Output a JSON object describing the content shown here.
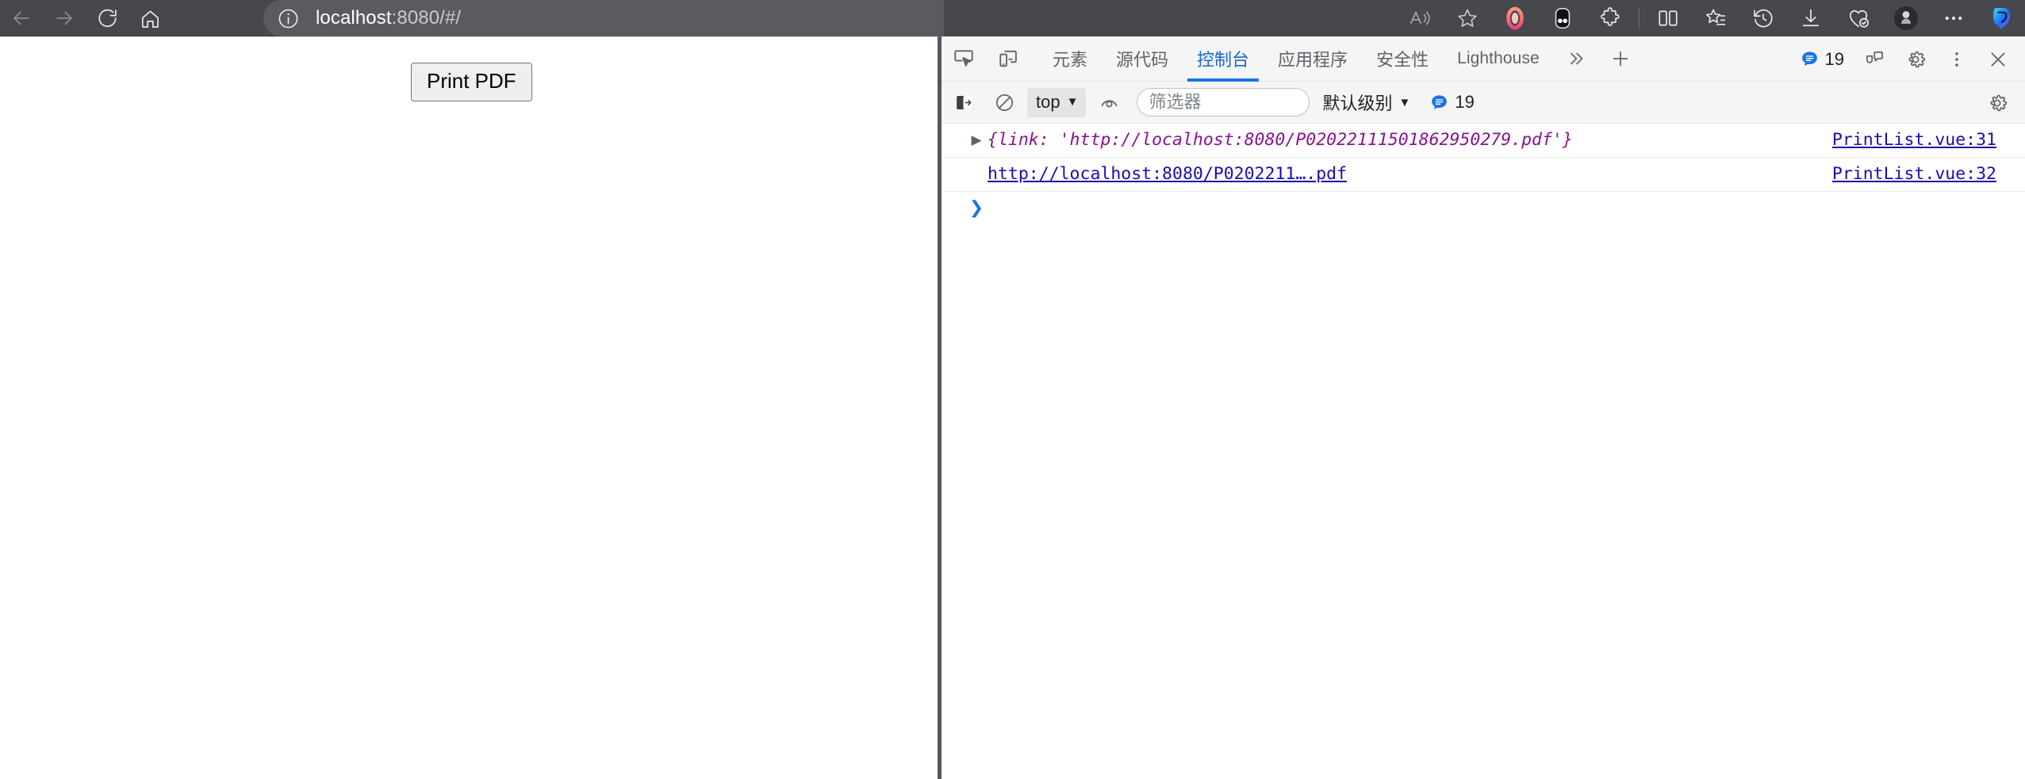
{
  "browser": {
    "nav": [
      {
        "name": "back-button",
        "icon": "arrow-left-icon",
        "enabled": false
      },
      {
        "name": "forward-button",
        "icon": "arrow-right-icon",
        "enabled": false
      },
      {
        "name": "refresh-button",
        "icon": "refresh-icon",
        "enabled": true
      },
      {
        "name": "home-button",
        "icon": "home-icon",
        "enabled": true
      }
    ],
    "address": {
      "site_info_icon": "info-circle-icon",
      "host": "localhost",
      "path": ":8080/#/",
      "full_url": "localhost:8080/#/"
    },
    "toolbar_right": [
      {
        "name": "read-aloud-button",
        "icon": "read-aloud-icon"
      },
      {
        "name": "add-favorite-button",
        "icon": "star-outline-icon"
      },
      {
        "name": "opera-extension-button",
        "icon": "pink-ring-icon"
      },
      {
        "name": "extension-button",
        "icon": "black-rounded-icon"
      },
      {
        "name": "extensions-button",
        "icon": "puzzle-piece-icon"
      },
      {
        "name": "split-screen-button",
        "icon": "split-screen-icon"
      },
      {
        "name": "collections-button",
        "icon": "collections-star-icon"
      },
      {
        "name": "history-button",
        "icon": "history-clock-icon"
      },
      {
        "name": "downloads-button",
        "icon": "download-arrow-icon"
      },
      {
        "name": "browser-essentials-button",
        "icon": "heart-pulse-icon"
      },
      {
        "name": "profile-button",
        "icon": "avatar-icon"
      },
      {
        "name": "settings-and-more-button",
        "icon": "ellipsis-icon"
      },
      {
        "name": "copilot-button",
        "icon": "copilot-icon"
      }
    ],
    "colors": {
      "toolbar_bg": "#47484d",
      "address_bg": "#5a5b60",
      "url_host": "#ffffff",
      "url_path": "#c9cacd"
    }
  },
  "page": {
    "print_pdf_button_label": "Print PDF"
  },
  "devtools": {
    "header_icons": [
      {
        "name": "inspect-element-icon",
        "title": "inspect"
      },
      {
        "name": "device-toolbar-icon",
        "title": "device emulation"
      }
    ],
    "tabs": [
      {
        "label": "元素",
        "name": "tab-elements",
        "active": false,
        "latin": false
      },
      {
        "label": "源代码",
        "name": "tab-sources",
        "active": false,
        "latin": false
      },
      {
        "label": "控制台",
        "name": "tab-console",
        "active": true,
        "latin": false
      },
      {
        "label": "应用程序",
        "name": "tab-application",
        "active": false,
        "latin": false
      },
      {
        "label": "安全性",
        "name": "tab-security",
        "active": false,
        "latin": false
      },
      {
        "label": "Lighthouse",
        "name": "tab-lighthouse",
        "active": false,
        "latin": true
      }
    ],
    "more_tabs_icon": "chevron-double-right-icon",
    "add_tab_icon": "plus-icon",
    "header_right": {
      "message_badge_icon": "speech-bubble-icon",
      "message_count": "19",
      "feedback_icon": "feedback-icon",
      "settings_icon": "gear-icon",
      "more_options_icon": "kebab-menu-icon",
      "close_icon": "close-x-icon"
    },
    "console_toolbar": {
      "sidebar_toggle_icon": "console-sidebar-icon",
      "clear_console_icon": "clear-console-icon",
      "context_value": "top",
      "context_caret_icon": "caret-down-icon",
      "live_expression_icon": "eye-icon",
      "filter_placeholder": "筛选器",
      "filter_value": "",
      "level_label": "默认级别",
      "level_caret_icon": "caret-down-icon",
      "issues_badge_icon": "speech-bubble-icon",
      "issues_count": "19",
      "console_settings_icon": "gear-icon"
    },
    "messages": [
      {
        "expand_arrow": "▶",
        "expandable": true,
        "type": "object",
        "text_prefix": "{link: ",
        "text_string": "'http://localhost:8080/P02022111501862950279.pdf'",
        "text_suffix": "}",
        "source": "PrintList.vue:31"
      },
      {
        "expand_arrow": "",
        "expandable": false,
        "type": "link",
        "link_text": "http://localhost:8080/P0202211….pdf",
        "source": "PrintList.vue:32"
      }
    ],
    "prompt_caret": "❯",
    "colors": {
      "toolbar_bg": "#f5f5f5",
      "active_tab": "#1a73e8",
      "object_preview": "#881391",
      "link": "#1a0dab",
      "badge_blue": "#1a73e8"
    }
  }
}
